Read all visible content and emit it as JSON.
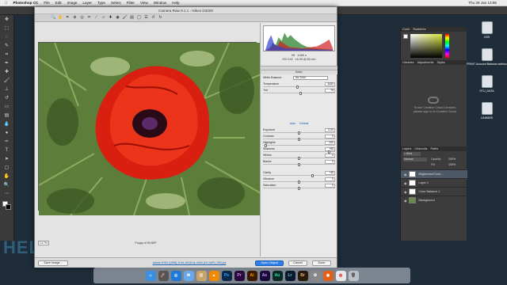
{
  "menubar": {
    "apple": "",
    "app_name": "Photoshop CC",
    "items": [
      "File",
      "Edit",
      "Image",
      "Layer",
      "Type",
      "Select",
      "Filter",
      "View",
      "Window",
      "Help"
    ],
    "clock": "Thu 28 Jan  13:56"
  },
  "dialog": {
    "title": "Camera Raw 9.1.1  -  Nikon D3200",
    "zoom_value": "13.7%",
    "filename": "Poppy of 93.NEF",
    "workflow_link": "Adobe RGB (1998); 8 bit; 6016 by 4000 (24.1MP); 300 ppi",
    "buttons": {
      "save": "Save Image...",
      "open": "Open Object",
      "cancel": "Cancel",
      "done": "Done"
    },
    "cam_stats": {
      "fstop": "f/8",
      "shutter": "1/160 s",
      "iso": "ISO 100",
      "lens": "18-55 @ 55 mm"
    },
    "panel_title": "Basic",
    "white_balance": {
      "label": "White Balance:",
      "value": "As Shot"
    },
    "auto_label": "Auto",
    "default_label": "Default",
    "sliders": [
      {
        "label": "Temperature",
        "value": "4450",
        "pos": 0.48
      },
      {
        "label": "Tint",
        "value": "+8",
        "pos": 0.52
      },
      {
        "label": "Exposure",
        "value": "0.00",
        "pos": 0.5
      },
      {
        "label": "Contrast",
        "value": "0",
        "pos": 0.5
      },
      {
        "label": "Highlights",
        "value": "-100",
        "pos": 0.02
      },
      {
        "label": "Shadows",
        "value": "+86",
        "pos": 0.93
      },
      {
        "label": "Whites",
        "value": "0",
        "pos": 0.5
      },
      {
        "label": "Blacks",
        "value": "0",
        "pos": 0.5
      },
      {
        "label": "Clarity",
        "value": "+38",
        "pos": 0.69
      },
      {
        "label": "Vibrance",
        "value": "0",
        "pos": 0.5
      },
      {
        "label": "Saturation",
        "value": "0",
        "pos": 0.5
      }
    ]
  },
  "panels": {
    "color_tabs": [
      "Color",
      "Swatches"
    ],
    "lib_tabs": [
      "Libraries",
      "Adjustments",
      "Styles"
    ],
    "library_message": "To use Creative Cloud Libraries, please sign in to Creative Cloud",
    "layer_tabs": [
      "Layers",
      "Channels",
      "Paths"
    ],
    "blend_mode": "Normal",
    "opacity": "100%",
    "fill": "100%",
    "layers": [
      "Brightness/Contr...",
      "Layer 1",
      "Color Balance 1",
      "Background"
    ]
  },
  "desktop": {
    "icons": [
      "OSS",
      "PRINT Account Balance.webloc",
      "STU_DATA",
      "U16650S"
    ]
  },
  "dock_apps": [
    "Finder",
    "Launchpad",
    "Safari",
    "Mail",
    "Contacts",
    "VLC",
    "Photoshop",
    "Premiere",
    "Illustrator",
    "After Effects",
    "Audition",
    "Lightroom",
    "Bridge",
    "Settings",
    "Firefox",
    "Chrome",
    "Trash"
  ],
  "colors": {
    "accent_blue": "#1a5fb4",
    "panel_dark": "#3c3c3c",
    "dialog_bg": "#e3e3e3"
  }
}
